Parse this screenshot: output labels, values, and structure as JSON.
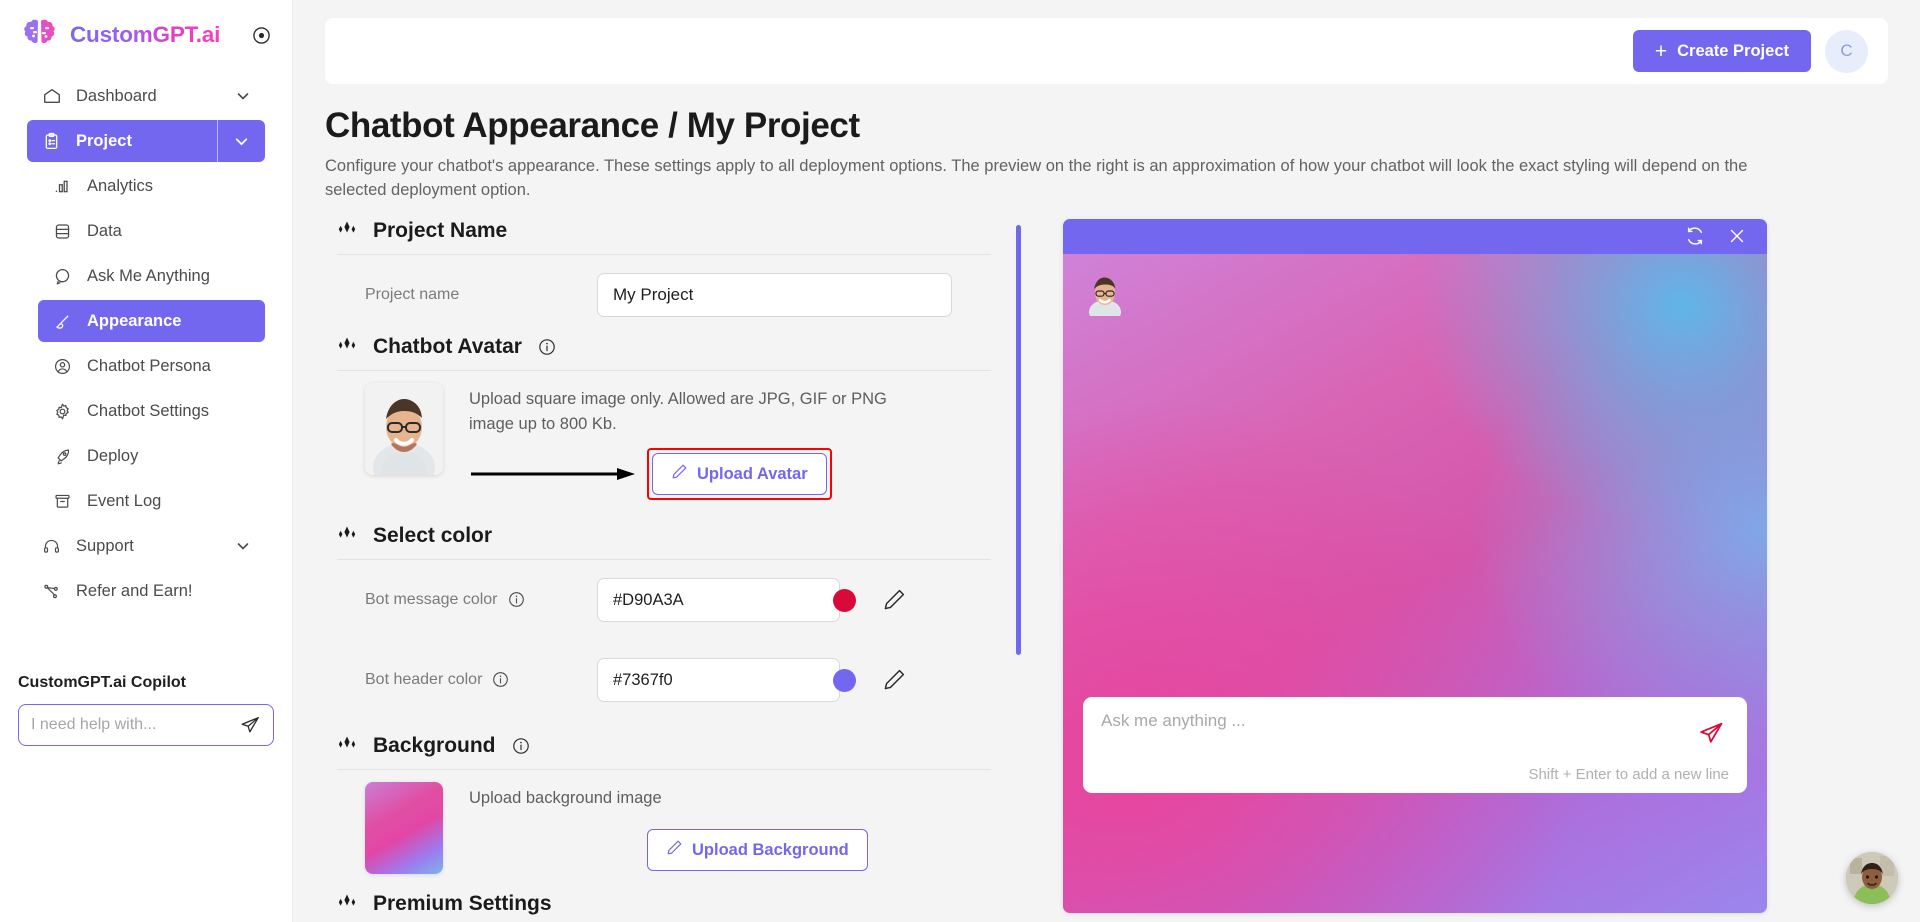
{
  "brand": {
    "name": "CustomGPT.ai",
    "logo_icon": "brain-icon",
    "collapse_icon": "collapse-circle-icon",
    "accent": "#7367f0",
    "gradient_from": "#7b68ee",
    "gradient_to": "#ff3fb4"
  },
  "sidebar": {
    "items": [
      {
        "label": "Dashboard",
        "icon": "home-icon",
        "active": false,
        "expandable": true
      },
      {
        "label": "Project",
        "icon": "clipboard-icon",
        "active": true,
        "expandable": true
      },
      {
        "label": "Analytics",
        "icon": "bar-chart-icon",
        "active": false,
        "sub": true
      },
      {
        "label": "Data",
        "icon": "database-icon",
        "active": false,
        "sub": true
      },
      {
        "label": "Ask Me Anything",
        "icon": "chat-bubble-icon",
        "active": false,
        "sub": true
      },
      {
        "label": "Appearance",
        "icon": "brush-icon",
        "active": true,
        "sub": true
      },
      {
        "label": "Chatbot Persona",
        "icon": "user-circle-icon",
        "active": false,
        "sub": true
      },
      {
        "label": "Chatbot Settings",
        "icon": "gear-icon",
        "active": false,
        "sub": true
      },
      {
        "label": "Deploy",
        "icon": "rocket-icon",
        "active": false,
        "sub": true
      },
      {
        "label": "Event Log",
        "icon": "archive-icon",
        "active": false,
        "sub": true
      },
      {
        "label": "Support",
        "icon": "headset-icon",
        "active": false,
        "expandable": true
      },
      {
        "label": "Refer and Earn!",
        "icon": "share-nodes-icon",
        "active": false
      }
    ],
    "copilot": {
      "title": "CustomGPT.ai Copilot",
      "placeholder": "I need help with...",
      "value": "",
      "send_icon": "paper-plane-icon"
    }
  },
  "topbar": {
    "create_label": "Create Project",
    "create_icon": "plus-icon",
    "avatar_initial": "C"
  },
  "page": {
    "title": "Chatbot Appearance / My Project",
    "description": "Configure your chatbot's appearance. These settings apply to all deployment options. The preview on the right is an approximation of how your chatbot will look the exact styling will depend on the selected deployment option."
  },
  "sections": {
    "project_name": {
      "title": "Project Name",
      "field_label": "Project name",
      "value": "My Project",
      "placeholder": "Project name"
    },
    "chatbot_avatar": {
      "title": "Chatbot Avatar",
      "has_info": true,
      "help_text": "Upload square image only. Allowed are JPG, GIF or PNG image up to 800 Kb.",
      "upload_label": "Upload Avatar",
      "upload_icon": "pencil-icon",
      "annotated": true,
      "annotation_color": "#ff0000"
    },
    "select_color": {
      "title": "Select color",
      "rows": [
        {
          "label": "Bot message color",
          "has_info": true,
          "value": "#D90A3A",
          "swatch": "#D90A3A",
          "edit_icon": "pencil-icon"
        },
        {
          "label": "Bot header color",
          "has_info": true,
          "value": "#7367f0",
          "swatch": "#7367f0",
          "edit_icon": "pencil-icon"
        }
      ]
    },
    "background": {
      "title": "Background",
      "has_info": true,
      "help_text": "Upload background image",
      "upload_label": "Upload Background",
      "upload_icon": "pencil-icon"
    },
    "premium_settings": {
      "title": "Premium Settings"
    }
  },
  "preview": {
    "header": {
      "refresh_icon": "refresh-icon",
      "close_icon": "close-icon",
      "color": "#7367f0"
    },
    "bot_avatar_icon": "bot-avatar-image",
    "input": {
      "placeholder": "Ask me anything ...",
      "value": "",
      "hint": "Shift + Enter to add a new line",
      "send_icon": "send-icon",
      "send_color": "#D90A3A"
    }
  },
  "floating_widget": {
    "icon": "support-agent-avatar"
  }
}
